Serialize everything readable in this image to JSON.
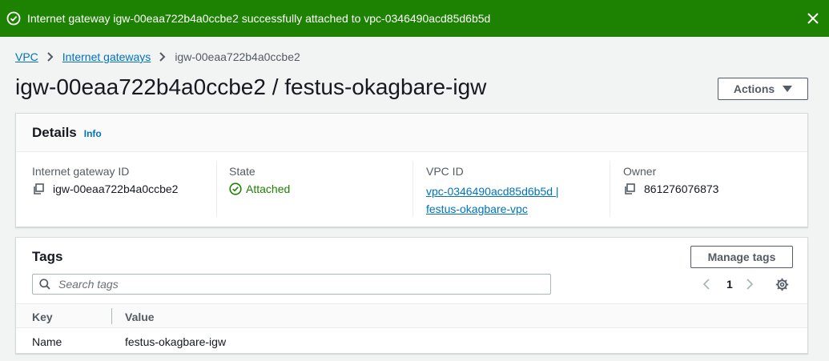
{
  "flash": {
    "message": "Internet gateway igw-00eaa722b4a0ccbe2 successfully attached to vpc-0346490acd85d6b5d",
    "icon": "success-circle-icon",
    "close_icon": "close-icon",
    "color": "#1d8102"
  },
  "breadcrumb": {
    "items": [
      "VPC",
      "Internet gateways"
    ],
    "current": "igw-00eaa722b4a0ccbe2"
  },
  "page": {
    "title": "igw-00eaa722b4a0ccbe2 / festus-okagbare-igw",
    "actions_label": "Actions"
  },
  "details": {
    "title": "Details",
    "info_label": "Info",
    "fields": {
      "igw_id": {
        "label": "Internet gateway ID",
        "value": "igw-00eaa722b4a0ccbe2"
      },
      "state": {
        "label": "State",
        "value": "Attached"
      },
      "vpc_id": {
        "label": "VPC ID",
        "value_line1": "vpc-0346490acd85d6b5d |",
        "value_line2": "festus-okagbare-vpc"
      },
      "owner": {
        "label": "Owner",
        "value": "861276076873"
      }
    }
  },
  "tags": {
    "title": "Tags",
    "manage_label": "Manage tags",
    "search_placeholder": "Search tags",
    "page_number": "1",
    "columns": [
      "Key",
      "Value"
    ],
    "rows": [
      {
        "key": "Name",
        "value": "festus-okagbare-igw"
      }
    ]
  },
  "colors": {
    "link": "#0073bb",
    "success": "#1d8102",
    "text": "#16191f"
  }
}
